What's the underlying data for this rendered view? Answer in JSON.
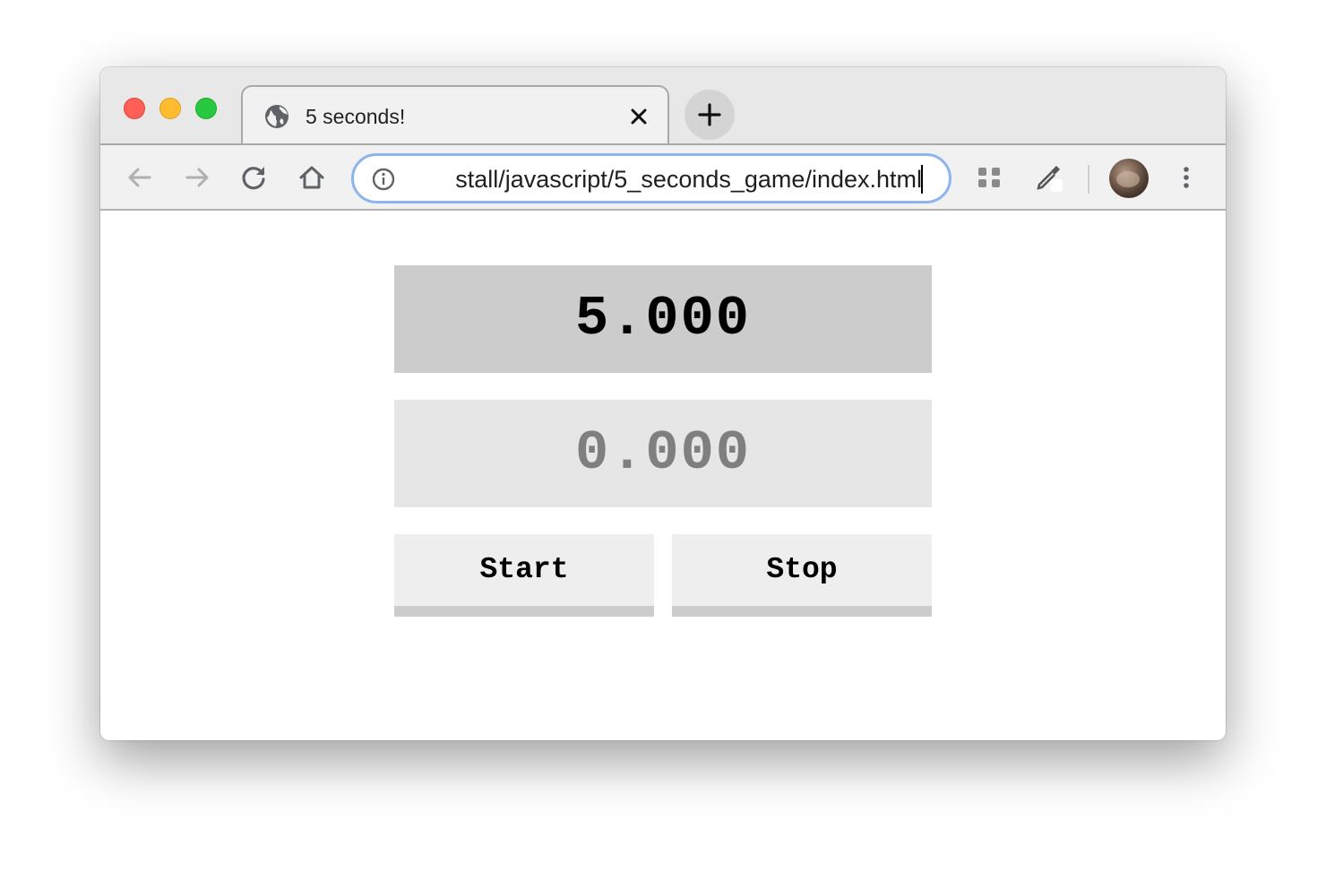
{
  "browser": {
    "tab": {
      "title": "5 seconds!",
      "icon": "globe-icon",
      "close_icon": "close-icon"
    },
    "new_tab_icon": "plus-icon",
    "nav": {
      "back_icon": "back-arrow-icon",
      "forward_icon": "forward-arrow-icon",
      "reload_icon": "reload-icon",
      "home_icon": "home-icon"
    },
    "address_bar": {
      "info_icon": "info-icon",
      "url": "stall/javascript/5_seconds_game/index.html"
    },
    "extensions": [
      "puzzle-extension-icon",
      "eyedropper-extension-icon"
    ],
    "avatar": "profile-avatar",
    "menu_icon": "kebab-menu-icon"
  },
  "game": {
    "target_time": "5.000",
    "elapsed_time": "0.000",
    "start_label": "Start",
    "stop_label": "Stop"
  },
  "colors": {
    "target_bg": "#cccccc",
    "elapsed_bg": "#e6e6e6",
    "elapsed_text": "#7f7f7f",
    "button_bg": "#eeeeee",
    "button_border": "#cccccc",
    "omnibox_focus": "#8db4ec"
  }
}
